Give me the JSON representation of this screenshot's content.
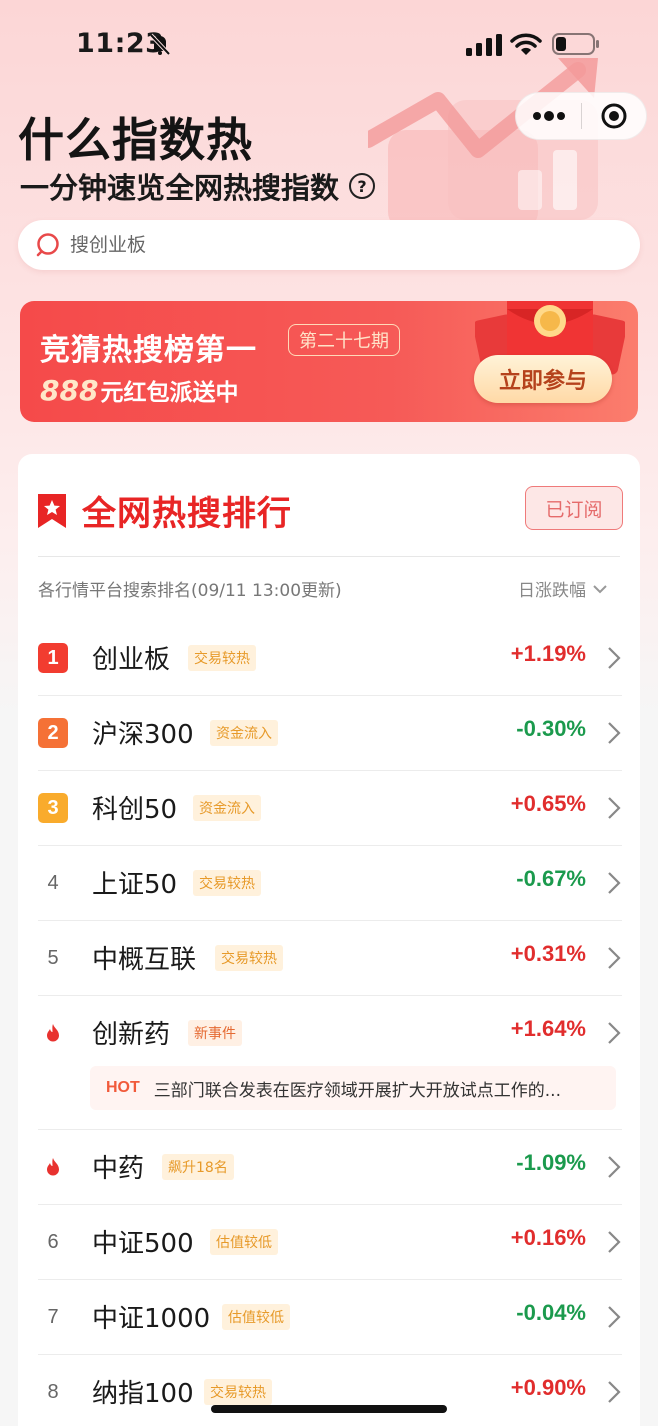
{
  "status_bar": {
    "time": "11:23"
  },
  "header": {
    "title": "什么指数热",
    "subtitle": "一分钟速览全网热搜指数",
    "help_icon": "?"
  },
  "search": {
    "placeholder": "搜创业板"
  },
  "banner": {
    "title": "竞猜热搜榜第一",
    "issue": "第二十七期",
    "amount": "888",
    "line2_rest": "元红包派送中",
    "button_label": "立即参与"
  },
  "ranking": {
    "title": "全网热搜排行",
    "subscribe_label": "已订阅",
    "meta": "各行情平台搜索排名(09/11 13:00更新)",
    "sort_label": "日涨跌幅",
    "rows": [
      {
        "rank": "1",
        "name": "创业板",
        "tag": "交易较热",
        "change": "+1.19%",
        "dir": "up"
      },
      {
        "rank": "2",
        "name": "沪深300",
        "tag": "资金流入",
        "change": "-0.30%",
        "dir": "down"
      },
      {
        "rank": "3",
        "name": "科创50",
        "tag": "资金流入",
        "change": "+0.65%",
        "dir": "up"
      },
      {
        "rank": "4",
        "name": "上证50",
        "tag": "交易较热",
        "change": "-0.67%",
        "dir": "down"
      },
      {
        "rank": "5",
        "name": "中概互联",
        "tag": "交易较热",
        "change": "+0.31%",
        "dir": "up"
      },
      {
        "rank": "",
        "name": "创新药",
        "tag": "新事件",
        "change": "+1.64%",
        "dir": "up",
        "hot_label": "HOT",
        "hot_text": "三部门联合发表在医疗领域开展扩大开放试点工作的..."
      },
      {
        "rank": "",
        "name": "中药",
        "tag": "飙升18名",
        "change": "-1.09%",
        "dir": "down"
      },
      {
        "rank": "6",
        "name": "中证500",
        "tag": "估值较低",
        "change": "+0.16%",
        "dir": "up"
      },
      {
        "rank": "7",
        "name": "中证1000",
        "tag": "估值较低",
        "change": "-0.04%",
        "dir": "down"
      },
      {
        "rank": "8",
        "name": "纳指100",
        "tag": "交易较热",
        "change": "+0.90%",
        "dir": "up"
      }
    ]
  },
  "colors": {
    "up": "#e12d2d",
    "down": "#1b9a4d",
    "accent": "#e82525"
  }
}
